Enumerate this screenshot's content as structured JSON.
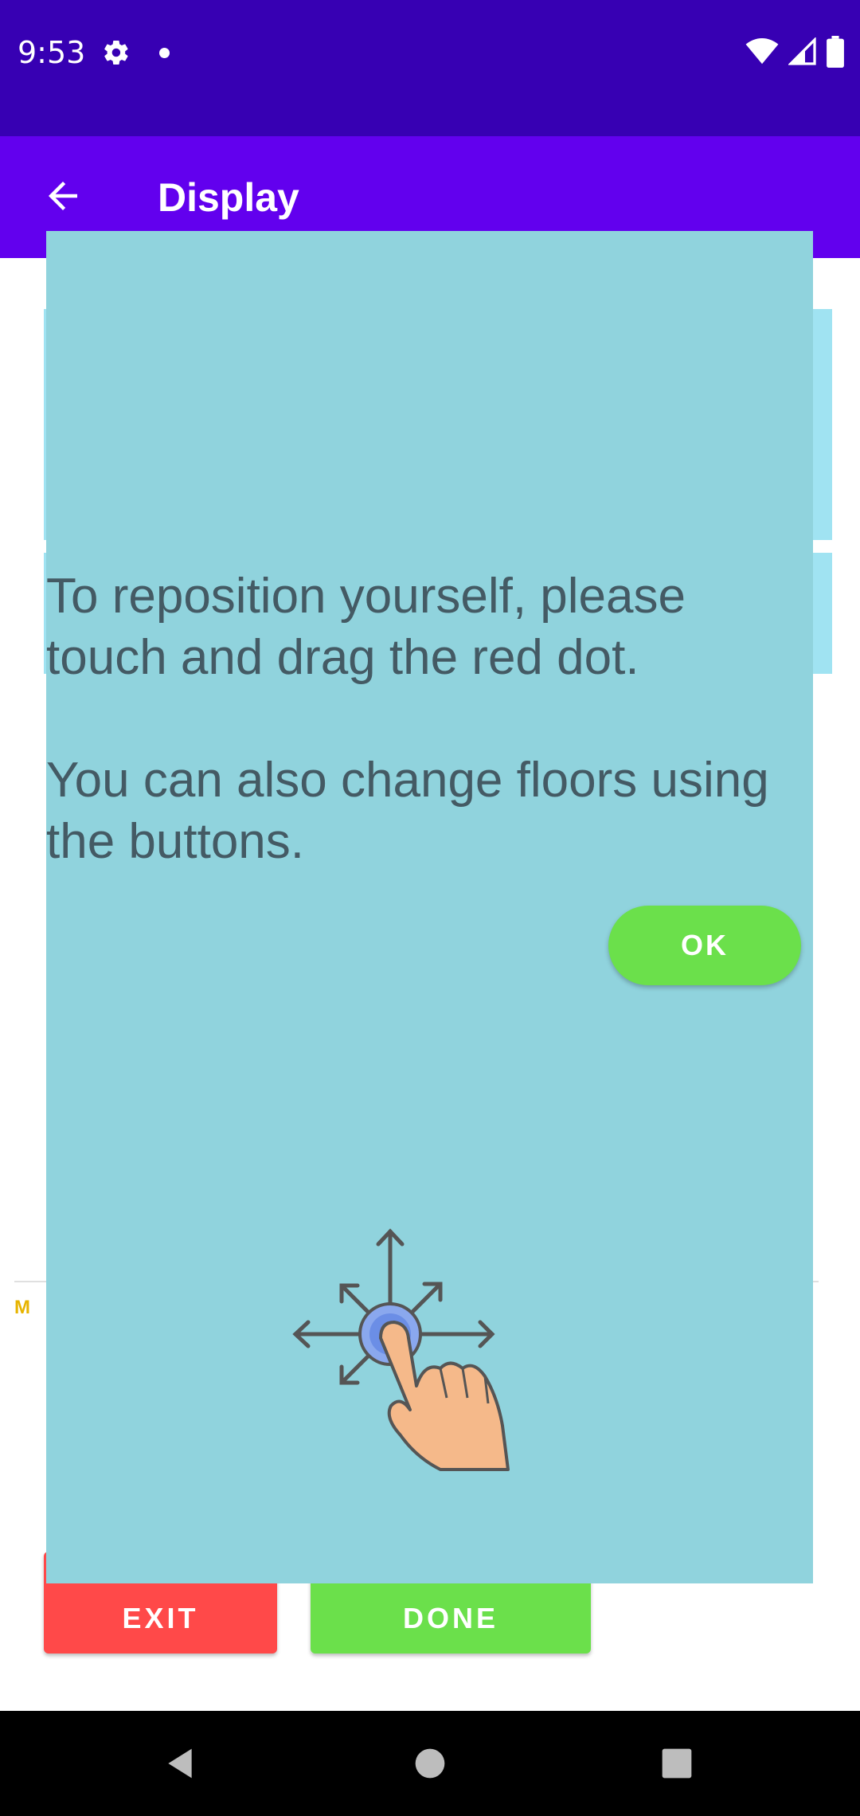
{
  "status_bar": {
    "time": "9:53",
    "icons": [
      "gear-icon",
      "notification-dot-icon",
      "wifi-icon",
      "signal-icon",
      "battery-icon"
    ],
    "color": "#3700b3"
  },
  "app_bar": {
    "title": "Display",
    "back_icon": "arrow-left-icon",
    "color": "#6200ee"
  },
  "background": {
    "map_logo": "M"
  },
  "buttons": {
    "exit_label": "EXIT",
    "exit_color": "#ff4949",
    "done_label": "DONE",
    "done_color": "#6be04b"
  },
  "dialog": {
    "message": "To reposition yourself, please touch and drag the red dot.\n\nYou can also change floors using the buttons.",
    "ok_label": "OK",
    "ok_color": "#6be04b",
    "background_color": "#90d3dd",
    "illustration_icon": "touch-drag-hand-icon"
  },
  "nav_bar": {
    "icons": [
      "nav-back-icon",
      "nav-home-icon",
      "nav-recents-icon"
    ]
  }
}
